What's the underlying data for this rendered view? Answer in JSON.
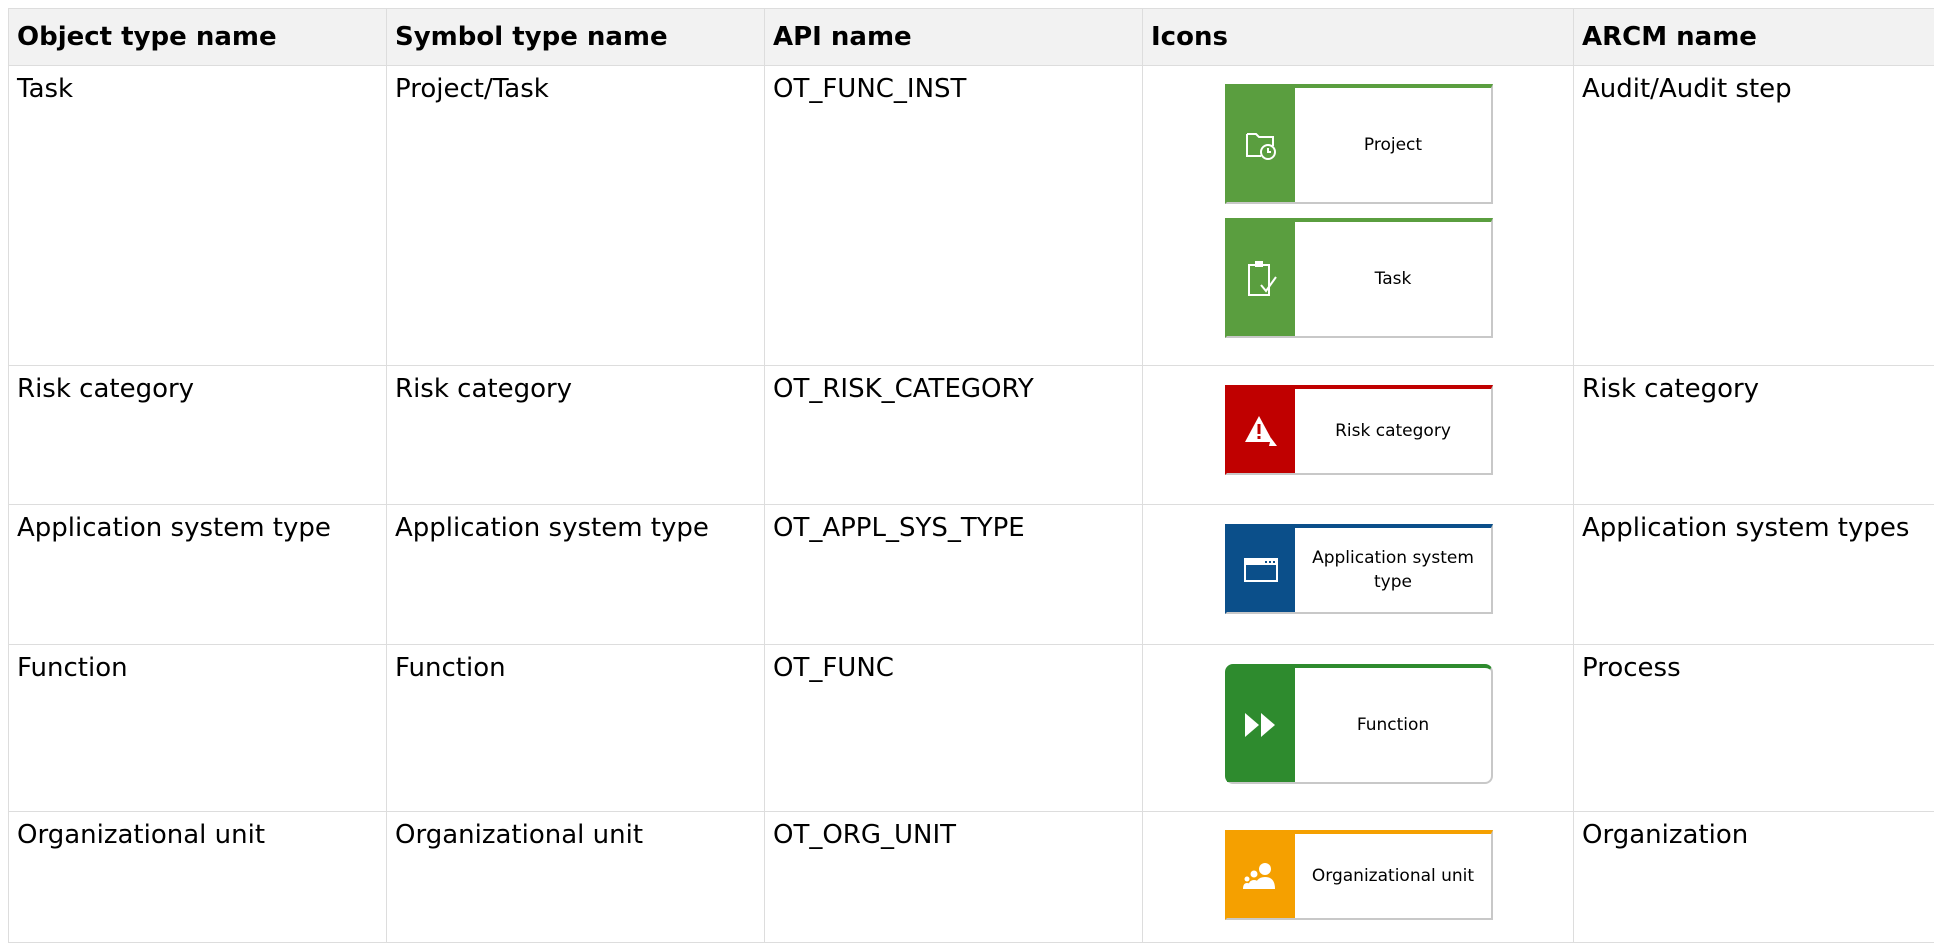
{
  "headers": [
    "Object type name",
    "Symbol type name",
    "API name",
    "Icons",
    "ARCM name"
  ],
  "rows": [
    {
      "object_type": "Task",
      "symbol_type": "Project/Task",
      "api_name": "OT_FUNC_INST",
      "arcm_name": "Audit/Audit step",
      "symbols": [
        {
          "label": "Project",
          "color": "#5a9e3f",
          "icon": "folder-clock-icon"
        },
        {
          "label": "Task",
          "color": "#5a9e3f",
          "icon": "clipboard-check-icon"
        }
      ]
    },
    {
      "object_type": "Risk category",
      "symbol_type": "Risk category",
      "api_name": "OT_RISK_CATEGORY",
      "arcm_name": "Risk category",
      "symbols": [
        {
          "label": "Risk category",
          "color": "#c00000",
          "icon": "warning-icon"
        }
      ]
    },
    {
      "object_type": "Application system type",
      "symbol_type": "Application system type",
      "api_name": "OT_APPL_SYS_TYPE",
      "arcm_name": "Application system types",
      "symbols": [
        {
          "label": "Application system type",
          "color": "#0b4f8a",
          "icon": "window-icon"
        }
      ]
    },
    {
      "object_type": "Function",
      "symbol_type": "Function",
      "api_name": "OT_FUNC",
      "arcm_name": "Process",
      "symbols": [
        {
          "label": "Function",
          "color": "#2e8b2e",
          "icon": "fast-forward-icon"
        }
      ]
    },
    {
      "object_type": "Organizational unit",
      "symbol_type": "Organizational unit",
      "api_name": "OT_ORG_UNIT",
      "arcm_name": "Organization",
      "symbols": [
        {
          "label": "Organizational unit",
          "color": "#f5a000",
          "icon": "people-icon"
        }
      ]
    }
  ]
}
